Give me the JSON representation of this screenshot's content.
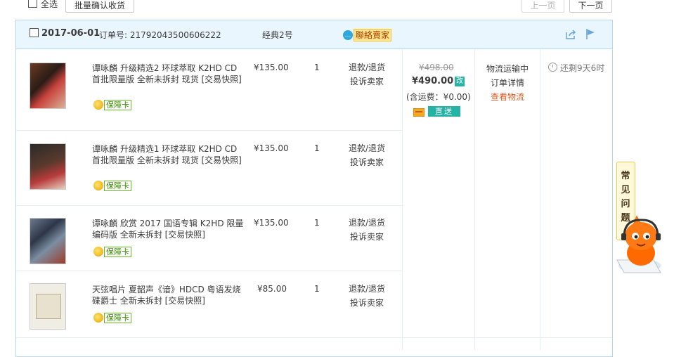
{
  "toolbar": {
    "select_all": "全选",
    "batch_confirm": "批量确认收货",
    "prev": "上一页",
    "next": "下一页"
  },
  "order": {
    "date": "2017-06-01",
    "order_no_label": "订单号: 21792043500606222",
    "shop": "经典2号",
    "contact_seller": "聯絡賣家",
    "contact_icon": "chat-bubble-icon",
    "share_icon": "share-icon",
    "flag_icon": "flag-icon",
    "items": [
      {
        "title": "谭咏麟 升级精选2 环球萃取 K2HD CD首批限量版 全新未拆封 现货 [交易快照]",
        "badge": "保障卡",
        "price": "¥135.00",
        "qty": "1",
        "refund": "退款/退货",
        "complaint": "投诉卖家"
      },
      {
        "title": "谭咏麟 升级精选1 环球萃取 K2HD CD首批限量版 全新未拆封 现货 [交易快照]",
        "badge": "保障卡",
        "price": "¥135.00",
        "qty": "1",
        "refund": "退款/退货",
        "complaint": "投诉卖家"
      },
      {
        "title": "谭咏麟 欣赏 2017 国语专辑 K2HD 限量编码版 全新未拆封 [交易快照]",
        "badge": "保障卡",
        "price": "¥135.00",
        "qty": "1",
        "refund": "退款/退货",
        "complaint": "投诉卖家"
      },
      {
        "title": "天弦唱片 夏韶声《谙》HDCD 粤语发烧碟爵士 全新未拆封 [交易快照]",
        "badge": "保障卡",
        "price": "¥85.00",
        "qty": "1",
        "refund": "退款/退货",
        "complaint": "投诉卖家"
      }
    ],
    "orig_total": "¥498.00",
    "pay_total": "¥490.00",
    "edit_tag": "改",
    "freight": "(含运费：¥0.00)",
    "direct": "直送",
    "status": "物流运输中",
    "detail_link": "订单详情",
    "logistics_link": "查看物流",
    "remaining": "还剩9天6时"
  },
  "faq": {
    "label": "常见问题",
    "chars": [
      "常",
      "见",
      "问",
      "题"
    ]
  },
  "colors": {
    "header_bg": "#eaf6fd",
    "border": "#b5d7f0",
    "accent_orange": "#e05a23",
    "teal_tag": "#24b3a5"
  }
}
